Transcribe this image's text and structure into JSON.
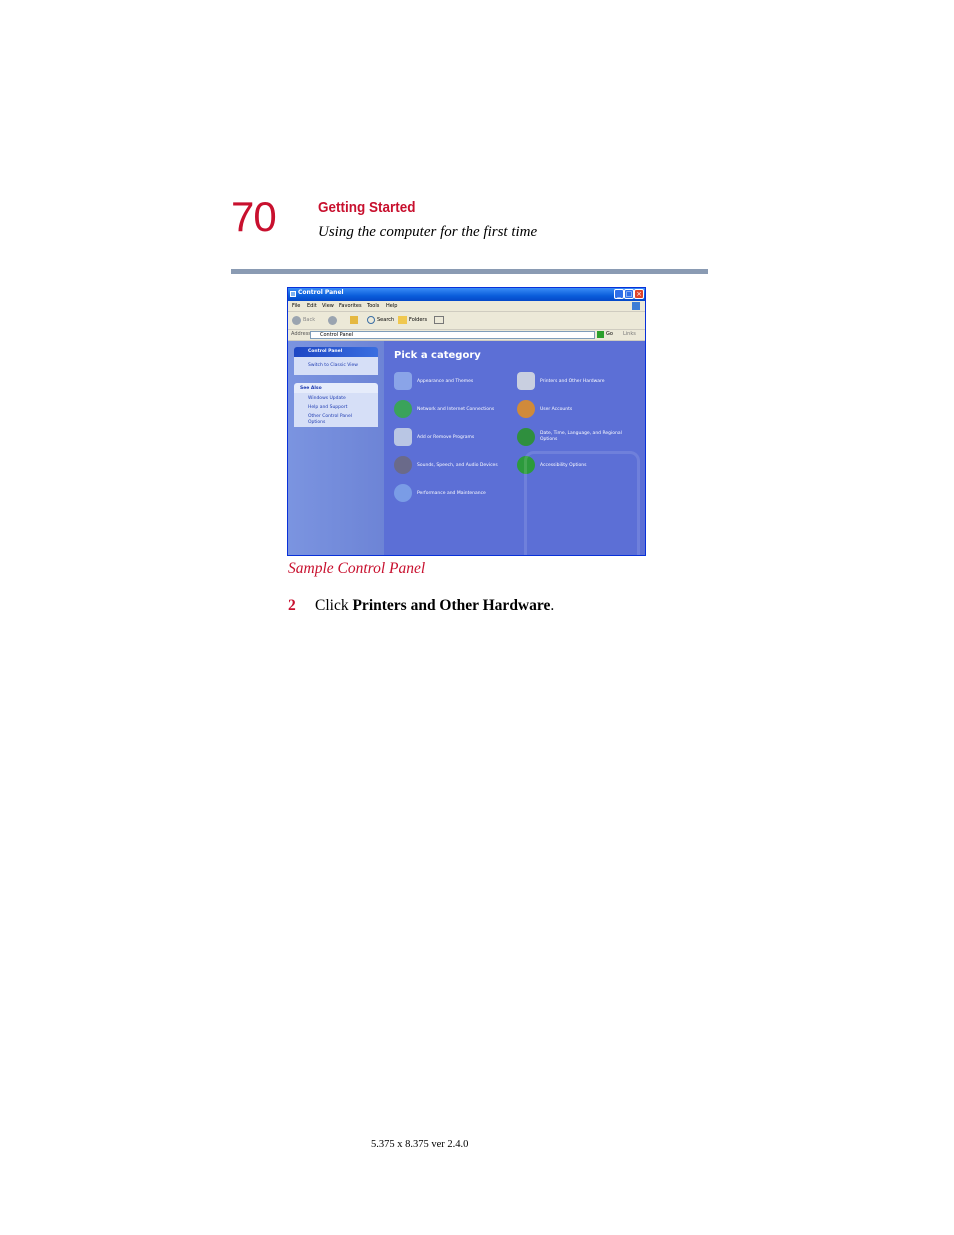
{
  "header": {
    "page_number": "70",
    "chapter": "Getting Started",
    "section": "Using the computer for the first time"
  },
  "window": {
    "title": "Control Panel",
    "menus": [
      "File",
      "Edit",
      "View",
      "Favorites",
      "Tools",
      "Help"
    ],
    "toolbar": {
      "back": "Back",
      "search": "Search",
      "folders": "Folders"
    },
    "address_label": "Address",
    "address_value": "Control Panel",
    "go": "Go",
    "links": "Links",
    "left_panel": {
      "title": "Control Panel",
      "switch_view": "Switch to Classic View",
      "see_also_title": "See Also",
      "see_also": [
        "Windows Update",
        "Help and Support",
        "Other Control Panel",
        "Options"
      ]
    },
    "pick_category": "Pick a category",
    "categories": [
      "Appearance and Themes",
      "Printers and Other Hardware",
      "Network and Internet Connections",
      "User Accounts",
      "Add or Remove Programs",
      "Date, Time, Language, and Regional",
      "Options",
      "Sounds, Speech, and Audio Devices",
      "Accessibility Options",
      "Performance and Maintenance"
    ],
    "colors": {
      "sidebar": "#7b94e0",
      "content": "#5c6fd6",
      "titlebar": "#0a5ddb"
    }
  },
  "caption": "Sample Control Panel",
  "step": {
    "number": "2",
    "prefix": "Click ",
    "bold": "Printers and Other Hardware",
    "suffix": "."
  },
  "footer": "5.375 x 8.375 ver 2.4.0"
}
